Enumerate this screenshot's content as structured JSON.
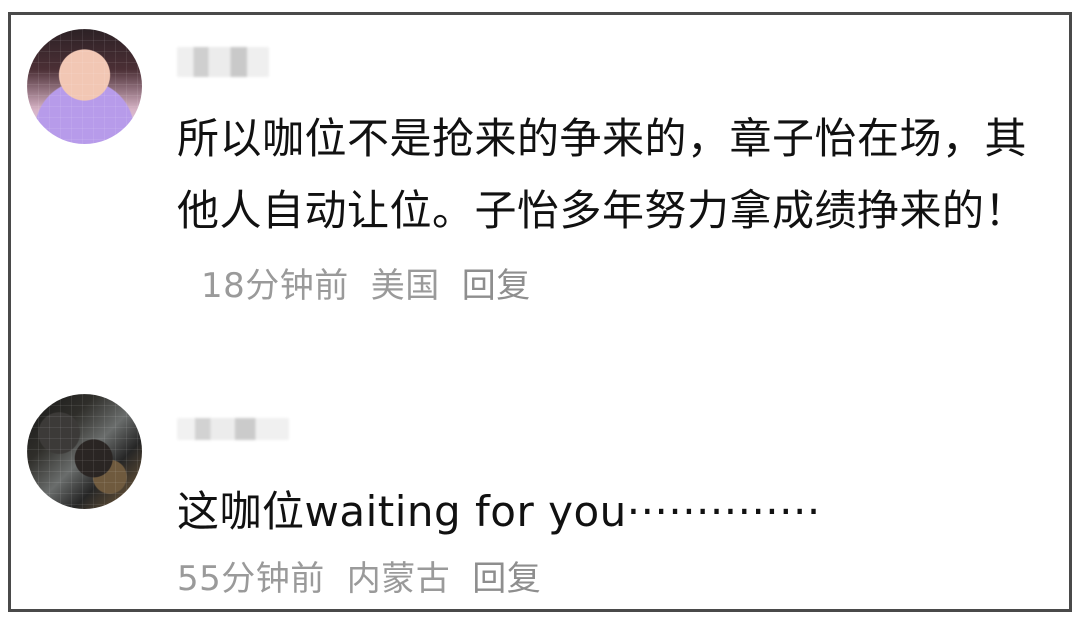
{
  "comments": [
    {
      "avatar_icon": "avatar-icon",
      "text": "所以咖位不是抢来的争来的，章子怡在场，其他人自动让位。子怡多年努力拿成绩挣来的！",
      "time": "18分钟前",
      "location": "美国",
      "reply": "回复"
    },
    {
      "avatar_icon": "avatar-icon",
      "text": "这咖位waiting for you··············",
      "time": "55分钟前",
      "location": "内蒙古",
      "reply": "回复"
    }
  ],
  "colors": {
    "text": "#111111",
    "meta": "#9A9A9A",
    "border": "#4A4A4A",
    "background": "#FFFFFF"
  }
}
